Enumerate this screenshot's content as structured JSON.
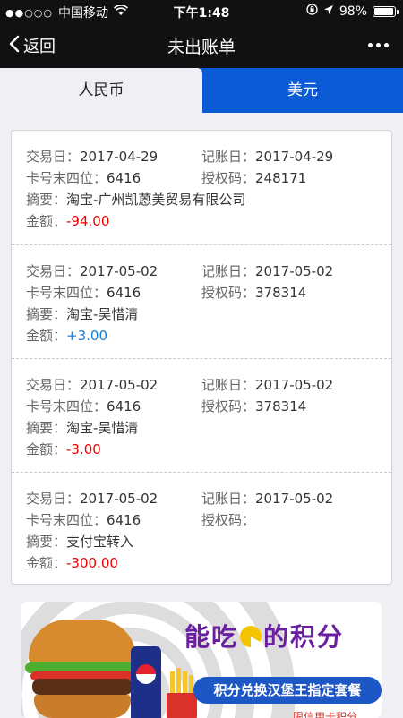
{
  "status_bar": {
    "carrier": "中国移动",
    "time": "下午1:48",
    "battery": "98%"
  },
  "nav": {
    "back_label": "返回",
    "title": "未出账单"
  },
  "tabs": [
    {
      "label": "人民币",
      "active": true
    },
    {
      "label": "美元",
      "active": false
    }
  ],
  "labels": {
    "trade_date": "交易日：",
    "post_date": "记账日：",
    "card_last4": "卡号末四位：",
    "auth_code": "授权码：",
    "summary": "摘要：",
    "amount": "金额："
  },
  "transactions": [
    {
      "trade_date": "2017-04-29",
      "post_date": "2017-04-29",
      "card_last4": "6416",
      "auth_code": "248171",
      "summary": "淘宝-广州凯蒽美贸易有限公司",
      "amount": "-94.00",
      "sign": "neg"
    },
    {
      "trade_date": "2017-05-02",
      "post_date": "2017-05-02",
      "card_last4": "6416",
      "auth_code": "378314",
      "summary": "淘宝-吴惜清",
      "amount": "+3.00",
      "sign": "pos"
    },
    {
      "trade_date": "2017-05-02",
      "post_date": "2017-05-02",
      "card_last4": "6416",
      "auth_code": "378314",
      "summary": "淘宝-吴惜清",
      "amount": "-3.00",
      "sign": "neg"
    },
    {
      "trade_date": "2017-05-02",
      "post_date": "2017-05-02",
      "card_last4": "6416",
      "auth_code": "",
      "summary": "支付宝转入",
      "amount": "-300.00",
      "sign": "neg"
    }
  ],
  "banner": {
    "slogan_part1": "能吃",
    "slogan_part2": "的积分",
    "button_text": "积分兑换汉堡王指定套餐",
    "footer_text": "限信用卡积分"
  },
  "colors": {
    "nav_bg": "#111111",
    "tab_active": "#0b5bd6",
    "amount_negative": "#ee0000",
    "amount_positive": "#1a7bd6"
  }
}
